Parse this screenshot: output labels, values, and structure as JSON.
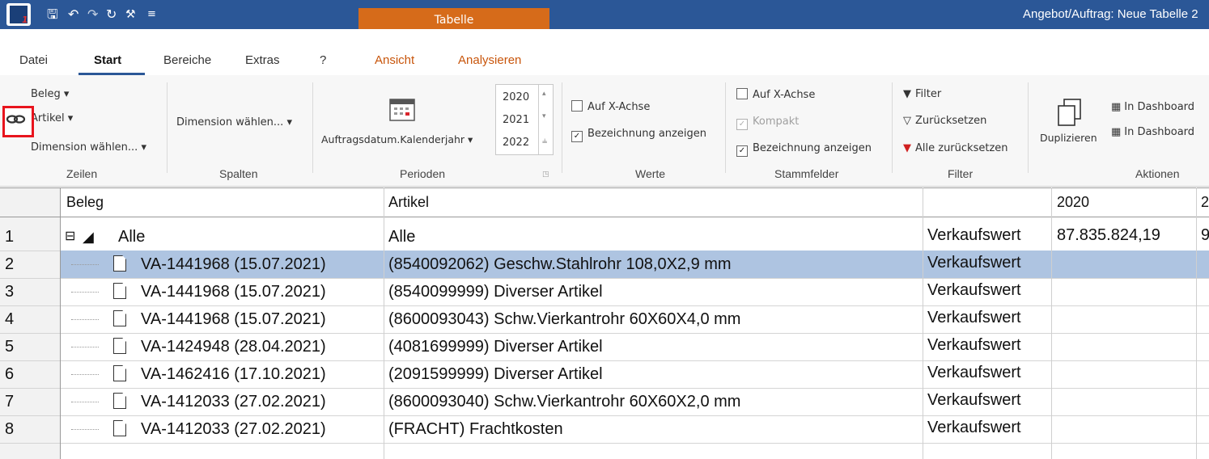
{
  "titlebar": {
    "qat_icons": [
      "save-icon",
      "undo-icon",
      "redo-icon",
      "refresh-icon",
      "tools-icon",
      "customize-qat-icon"
    ],
    "context_tab": "Tabelle",
    "window_title": "Angebot/Auftrag: Neue Tabelle 2"
  },
  "menu": {
    "items": [
      "Datei",
      "Start",
      "Bereiche",
      "Extras",
      "?",
      "Ansicht",
      "Analysieren"
    ],
    "active": "Start"
  },
  "ribbon": {
    "zeilen": {
      "beleg": "Beleg ▾",
      "artikel": "Artikel ▾",
      "dimension": "Dimension wählen... ▾",
      "label": "Zeilen"
    },
    "spalten": {
      "dimension": "Dimension wählen... ▾",
      "label": "Spalten"
    },
    "perioden": {
      "field": "Auftragsdatum.Kalenderjahr ▾",
      "years": [
        "2020",
        "2021",
        "2022"
      ],
      "label": "Perioden"
    },
    "werte": {
      "x_achse": "Auf X-Achse",
      "bezeichnung": "Bezeichnung anzeigen",
      "label": "Werte"
    },
    "stammfelder": {
      "x_achse": "Auf X-Achse",
      "kompakt": "Kompakt",
      "bezeichnung": "Bezeichnung anzeigen",
      "label": "Stammfelder"
    },
    "filter": {
      "filter": "Filter",
      "zuruecksetzen": "Zurücksetzen",
      "alle": "Alle zurücksetzen",
      "label": "Filter"
    },
    "aktionen": {
      "duplizieren": "Duplizieren",
      "dashboard1": "In Dashboard",
      "dashboard2": "In Dashboard",
      "label": "Aktionen"
    }
  },
  "table": {
    "headers": {
      "beleg": "Beleg",
      "artikel": "Artikel",
      "year1": "2020",
      "year2": "2"
    },
    "rows": [
      {
        "num": "1",
        "beleg": "Alle",
        "artikel": "Alle",
        "wert": "Verkaufswert",
        "y2020": "87.835.824,19",
        "y2021": "9"
      },
      {
        "num": "2",
        "beleg": "VA-1441968 (15.07.2021)",
        "artikel": "(8540092062) Geschw.Stahlrohr 108,0X2,9 mm",
        "wert": "Verkaufswert",
        "y2020": "",
        "y2021": ""
      },
      {
        "num": "3",
        "beleg": "VA-1441968 (15.07.2021)",
        "artikel": "(8540099999) Diverser Artikel",
        "wert": "Verkaufswert",
        "y2020": "",
        "y2021": ""
      },
      {
        "num": "4",
        "beleg": "VA-1441968 (15.07.2021)",
        "artikel": "(8600093043) Schw.Vierkantrohr   60X60X4,0 mm",
        "wert": "Verkaufswert",
        "y2020": "",
        "y2021": ""
      },
      {
        "num": "5",
        "beleg": "VA-1424948 (28.04.2021)",
        "artikel": "(4081699999) Diverser Artikel",
        "wert": "Verkaufswert",
        "y2020": "",
        "y2021": ""
      },
      {
        "num": "6",
        "beleg": "VA-1462416 (17.10.2021)",
        "artikel": "(2091599999) Diverser Artikel",
        "wert": "Verkaufswert",
        "y2020": "",
        "y2021": ""
      },
      {
        "num": "7",
        "beleg": "VA-1412033 (27.02.2021)",
        "artikel": "(8600093040) Schw.Vierkantrohr   60X60X2,0 mm",
        "wert": "Verkaufswert",
        "y2020": "",
        "y2021": ""
      },
      {
        "num": "8",
        "beleg": "VA-1412033 (27.02.2021)",
        "artikel": "(FRACHT) Frachtkosten",
        "wert": "Verkaufswert",
        "y2020": "",
        "y2021": ""
      }
    ]
  },
  "colors": {
    "titlebar": "#2b5797",
    "context_tab": "#d66b1a",
    "selection": "#aec4e1",
    "highlight_box": "#e8141d"
  }
}
